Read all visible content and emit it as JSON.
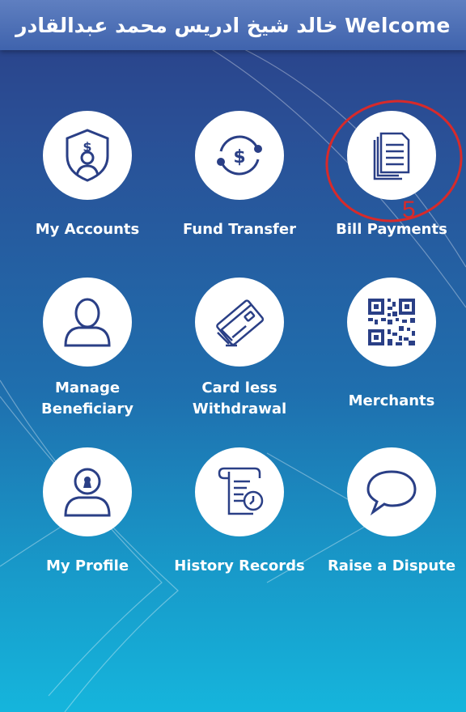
{
  "header": {
    "title": "خالد شيخ ادريس محمد عبدالقادر Welcome"
  },
  "menu": [
    {
      "label": "My Accounts",
      "icon": "account-shield-icon"
    },
    {
      "label": "Fund Transfer",
      "icon": "fund-transfer-icon"
    },
    {
      "label": "Bill Payments",
      "icon": "documents-icon"
    },
    {
      "label": "Manage\nBeneficiary",
      "icon": "person-icon"
    },
    {
      "label": "Card less\nWithdrawal",
      "icon": "card-icon"
    },
    {
      "label": "Merchants",
      "icon": "qr-code-icon"
    },
    {
      "label": "My Profile",
      "icon": "profile-lock-icon"
    },
    {
      "label": "History Records",
      "icon": "history-scroll-icon"
    },
    {
      "label": "Raise a Dispute",
      "icon": "speech-bubble-icon"
    }
  ],
  "annotation": {
    "number": "5",
    "color": "#d82a2a"
  },
  "colors": {
    "accent": "#2a3f86",
    "header": "#4a6db5",
    "tile": "#ffffff"
  }
}
